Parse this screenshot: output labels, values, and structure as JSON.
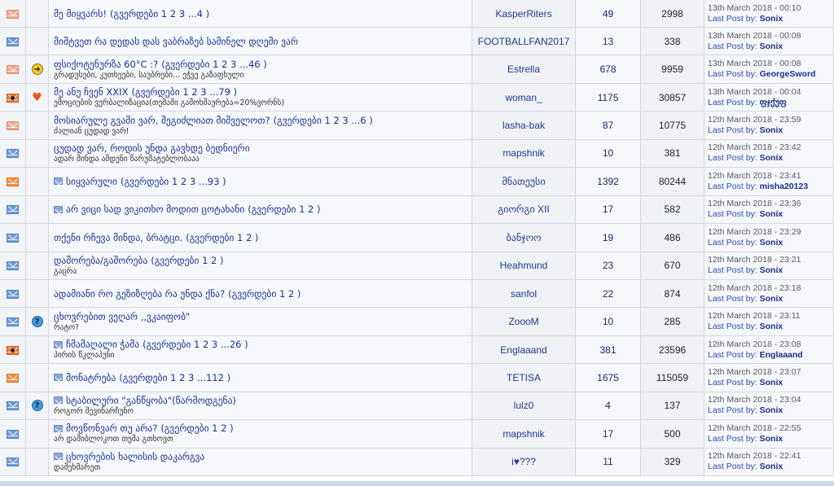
{
  "last_post_label": "Last Post by:",
  "topics": [
    {
      "icon": "env-pink",
      "post_icon": "",
      "mini": false,
      "title": "მე მიყვარს!",
      "pages": "(გვერდები 1 2 3 ...4 )",
      "subtitle": "",
      "author": "KasperRiters",
      "replies": "49",
      "views": "2998",
      "date": "13th March 2018 - 00:10",
      "last_poster": "Sonix"
    },
    {
      "icon": "env-blue",
      "post_icon": "",
      "mini": false,
      "title": "მიმტვეთ რა დედას დას ვაბრაზებ სამინელ დღემი ვარ",
      "pages": "",
      "subtitle": "",
      "author": "FOOTBALLFAN2017",
      "replies": "13",
      "views": "338",
      "date": "13th March 2018 - 00:08",
      "last_poster": "Sonix"
    },
    {
      "icon": "env-pink",
      "post_icon": "arrow",
      "mini": false,
      "title": "ფსიქოტენურზა 60°C :?",
      "pages": "(გვერდები 1 2 3 ...46 )",
      "subtitle": "გრადუსები, კუთხეები, საუბრები... ეჭვე გაზაფხული",
      "author": "Estrella",
      "replies": "678",
      "views": "9959",
      "date": "13th March 2018 - 00:08",
      "last_poster": "GeorgeSword"
    },
    {
      "icon": "env-hot",
      "post_icon": "heart",
      "mini": false,
      "title": "მე ანუ ჩვენ XXIX",
      "pages": "(გვერდები 1 2 3 ...79 )",
      "subtitle": "ემოციების ვერბალიზაცია(თემაში გამოხმაურება=20%ვორნს)",
      "author": "woman_",
      "replies": "1175",
      "views": "30857",
      "date": "13th March 2018 - 00:04",
      "last_poster": "ფჯქუფ"
    },
    {
      "icon": "env-pink",
      "post_icon": "",
      "mini": false,
      "title": "მოსიარულე გვამი ვარ, შეგიძლიათ მიშველოთ?",
      "pages": "(გვერდები 1 2 3 ...6 )",
      "subtitle": "ძალიან ცუდად ვარ!",
      "author": "lasha-bak",
      "replies": "87",
      "views": "10775",
      "date": "12th March 2018 - 23:59",
      "last_poster": "Sonix"
    },
    {
      "icon": "env-blue",
      "post_icon": "",
      "mini": false,
      "title": "ცუდად ვარ, როდის უნდა გავხდე ბედნიერი",
      "pages": "",
      "subtitle": "ადარ მინდა ამდენი წარუმატებლობააა",
      "author": "mapshnik",
      "replies": "10",
      "views": "381",
      "date": "12th March 2018 - 23:42",
      "last_poster": "Sonix"
    },
    {
      "icon": "env-orange",
      "post_icon": "",
      "mini": true,
      "title": "სიყვარული",
      "pages": "(გვერდები 1 2 3 ...93 )",
      "subtitle": "",
      "author": "მნათეუსი",
      "replies": "1392",
      "views": "80244",
      "date": "12th March 2018 - 23:41",
      "last_poster": "misha20123"
    },
    {
      "icon": "env-blue",
      "post_icon": "",
      "mini": true,
      "title": "არ ვიცი სად ვიკითხო მოდით ცოტახანი",
      "pages": "(გვერდები 1 2 )",
      "subtitle": "",
      "author": "გიორგი XII",
      "replies": "17",
      "views": "582",
      "date": "12th March 2018 - 23:36",
      "last_poster": "Sonix"
    },
    {
      "icon": "env-blue",
      "post_icon": "",
      "mini": false,
      "title": "თქენი რჩევა მინდა, ბრატცი.",
      "pages": "(გვერდები 1 2 )",
      "subtitle": "",
      "author": "ბანჯოო",
      "replies": "19",
      "views": "486",
      "date": "12th March 2018 - 23:29",
      "last_poster": "Sonix"
    },
    {
      "icon": "env-blue",
      "post_icon": "",
      "mini": false,
      "title": "დაშორება/გაშორება",
      "pages": "(გვერდები 1 2 )",
      "subtitle": "გაცრა",
      "author": "Heahmund",
      "replies": "23",
      "views": "670",
      "date": "12th March 2018 - 23:21",
      "last_poster": "Sonix"
    },
    {
      "icon": "env-blue",
      "post_icon": "",
      "mini": false,
      "title": "ადამიანი რო გეზიზღება რა უნდა ქნა?",
      "pages": "(გვერდები 1 2 )",
      "subtitle": "",
      "author": "sanfol",
      "replies": "22",
      "views": "874",
      "date": "12th March 2018 - 23:18",
      "last_poster": "Sonix"
    },
    {
      "icon": "env-blue",
      "post_icon": "q",
      "mini": false,
      "title": "ცხოვრებით ვეღარ ,,ვკაიფობ\"",
      "pages": "",
      "subtitle": "რატო?",
      "author": "ZoooM",
      "replies": "10",
      "views": "285",
      "date": "12th March 2018 - 23:11",
      "last_poster": "Sonix"
    },
    {
      "icon": "env-hot",
      "post_icon": "",
      "mini": true,
      "title": "ჩმამაღალი ჭამა",
      "pages": "(გვერდები 1 2 3 ...26 )",
      "subtitle": "პირის წკლაპუნი",
      "author": "Englaaand",
      "replies": "381",
      "views": "23596",
      "date": "12th March 2018 - 23:08",
      "last_poster": "Englaaand"
    },
    {
      "icon": "env-orange",
      "post_icon": "",
      "mini": true,
      "title": "მონატრება",
      "pages": "(გვერდები 1 2 3 ...112 )",
      "subtitle": "",
      "author": "TETISA",
      "replies": "1675",
      "views": "115059",
      "date": "12th March 2018 - 23:07",
      "last_poster": "Sonix"
    },
    {
      "icon": "env-blue",
      "post_icon": "q",
      "mini": true,
      "title": "სტაბილური \"განწყობა\"(წარმოდგენა)",
      "pages": "",
      "subtitle": "როგორ შევინარჩუნო",
      "author": "lulz0",
      "replies": "4",
      "views": "137",
      "date": "12th March 2018 - 23:04",
      "last_poster": "Sonix"
    },
    {
      "icon": "env-blue",
      "post_icon": "",
      "mini": true,
      "title": "მოვწონვარ თუ არა?",
      "pages": "(გვერდები 1 2 )",
      "subtitle": "არ დამიბლოკოთ თემა გთხოვთ",
      "author": "mapshnik",
      "replies": "17",
      "views": "500",
      "date": "12th March 2018 - 22:55",
      "last_poster": "Sonix"
    },
    {
      "icon": "env-blue",
      "post_icon": "",
      "mini": true,
      "title": "ცხოვრების ხალისის დაკარგვა",
      "pages": "",
      "subtitle": "დამეხმარეთ",
      "author": "i♥???",
      "replies": "11",
      "views": "329",
      "date": "12th March 2018 - 22:41",
      "last_poster": "Sonix"
    }
  ]
}
